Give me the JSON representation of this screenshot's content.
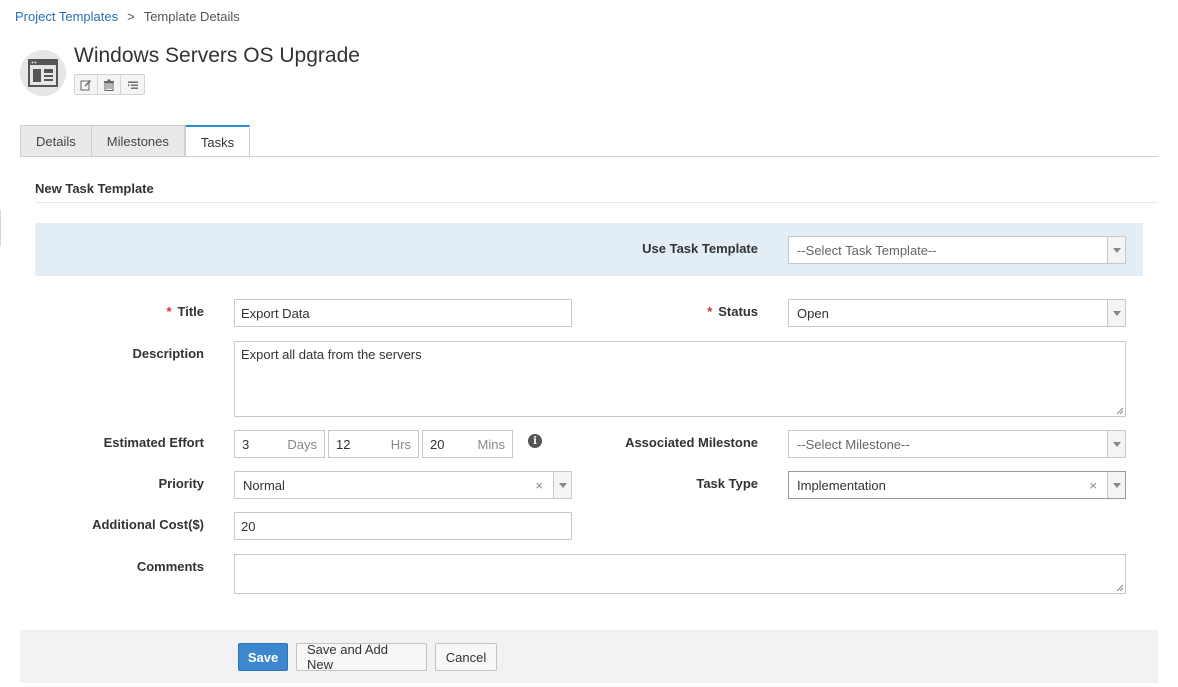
{
  "breadcrumb": {
    "root": "Project Templates",
    "separator": ">",
    "current": "Template Details"
  },
  "header": {
    "title": "Windows Servers OS Upgrade",
    "icon": "template-window-icon",
    "tools": [
      "edit-icon",
      "trash-icon",
      "list-indent-icon"
    ]
  },
  "tabs": [
    {
      "label": "Details",
      "active": false
    },
    {
      "label": "Milestones",
      "active": false
    },
    {
      "label": "Tasks",
      "active": true
    }
  ],
  "section": {
    "title": "New Task Template"
  },
  "form": {
    "use_template": {
      "label": "Use Task Template",
      "placeholder": "--Select Task Template--"
    },
    "title": {
      "label": "Title",
      "required_mark": "*",
      "value": "Export Data"
    },
    "status": {
      "label": "Status",
      "required_mark": "*",
      "value": "Open"
    },
    "description": {
      "label": "Description",
      "value": "Export all data from the servers"
    },
    "effort": {
      "label": "Estimated Effort",
      "days": "3",
      "days_unit": "Days",
      "hrs": "12",
      "hrs_unit": "Hrs",
      "mins": "20",
      "mins_unit": "Mins",
      "info_glyph": "i"
    },
    "milestone": {
      "label": "Associated Milestone",
      "placeholder": "--Select Milestone--"
    },
    "priority": {
      "label": "Priority",
      "value": "Normal",
      "clear": "×"
    },
    "task_type": {
      "label": "Task Type",
      "value": "Implementation",
      "clear": "×"
    },
    "cost": {
      "label": "Additional Cost($)",
      "value": "20"
    },
    "comments": {
      "label": "Comments",
      "value": ""
    }
  },
  "actions": {
    "save": "Save",
    "save_add": "Save and Add New",
    "cancel": "Cancel"
  },
  "colors": {
    "primary": "#3d87cf",
    "link": "#2a6fb3",
    "band": "#e2edf5",
    "required": "#d9302c",
    "tab_active": "#2a8fd6"
  }
}
